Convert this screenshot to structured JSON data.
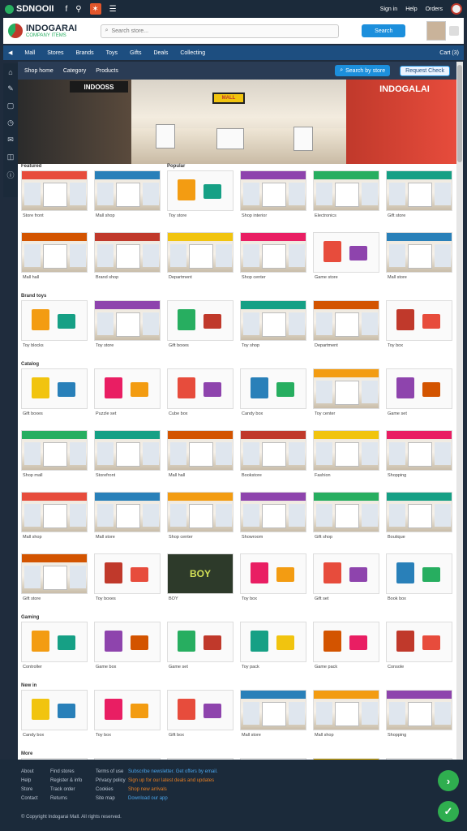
{
  "topbar": {
    "brand": "SDNOOII",
    "icons": [
      "facebook-icon",
      "share-icon",
      "pinwheel-icon",
      "menu-icon"
    ],
    "right": [
      "Sign in",
      "Help",
      "Orders"
    ]
  },
  "header": {
    "logo_title": "INDOGARAI",
    "logo_subtitle": "COMPANY ITEMS",
    "search_placeholder": "Search store...",
    "button_label": "Search"
  },
  "nav": {
    "items": [
      "Mall",
      "Stores",
      "Brands",
      "Toys",
      "Gifts",
      "Deals",
      "Collecting"
    ],
    "right": "Cart (3)"
  },
  "toolbar": {
    "items": [
      "Shop home",
      "Category",
      "Products"
    ],
    "button1": "Search by store",
    "button2": "Request Check"
  },
  "hero": {
    "left_sign": "INDOOSS",
    "right_sign": "INDOGALAI",
    "banner": "MALL"
  },
  "sections": [
    {
      "label": "Featured",
      "label2": "Popular",
      "rows": [
        {
          "caps": [
            "Store front",
            "Mall shop",
            "Toy store",
            "Shop interior",
            "Electronics",
            "Gift store"
          ],
          "types": [
            "store",
            "store",
            "prod",
            "store",
            "store",
            "store"
          ]
        },
        {
          "caps": [
            "Mall hall",
            "Brand shop",
            "Department",
            "Shop center",
            "Game store",
            "Mall store"
          ],
          "types": [
            "store",
            "store",
            "store",
            "store",
            "prod",
            "store"
          ]
        }
      ]
    },
    {
      "label": "Brand toys",
      "rows": [
        {
          "caps": [
            "Toy blocks",
            "Toy store",
            "Gift boxes",
            "Toy shop",
            "Department",
            "Toy box"
          ],
          "types": [
            "prod",
            "store",
            "prod",
            "store",
            "store",
            "prod"
          ]
        }
      ]
    },
    {
      "label": "Catalog",
      "rows": [
        {
          "caps": [
            "Gift boxes",
            "Puzzle set",
            "Cube box",
            "Candy box",
            "Toy center",
            "Game set"
          ],
          "types": [
            "prod",
            "prod",
            "prod",
            "prod",
            "store",
            "prod"
          ]
        },
        {
          "caps": [
            "Shop mall",
            "Storefront",
            "Mall hall",
            "Bookstore",
            "Fashion",
            "Shopping"
          ],
          "types": [
            "store",
            "store",
            "store",
            "store",
            "store",
            "store"
          ]
        },
        {
          "caps": [
            "Mall shop",
            "Mall store",
            "Shop center",
            "Showroom",
            "Gift shop",
            "Boutique"
          ],
          "types": [
            "store",
            "store",
            "store",
            "store",
            "store",
            "store"
          ]
        },
        {
          "caps": [
            "Gift store",
            "Toy boxes",
            "BOY",
            "Toy box",
            "Gift set",
            "Book box"
          ],
          "types": [
            "store",
            "prod",
            "dark",
            "prod",
            "prod",
            "prod"
          ]
        }
      ]
    },
    {
      "label": "Gaming",
      "rows": [
        {
          "caps": [
            "Controller",
            "Game box",
            "Game set",
            "Toy pack",
            "Game pack",
            "Console"
          ],
          "types": [
            "prod",
            "prod",
            "prod",
            "prod",
            "prod",
            "prod"
          ]
        }
      ]
    },
    {
      "label": "New in",
      "rows": [
        {
          "caps": [
            "Candy box",
            "Toy box",
            "Gift box",
            "Mall store",
            "Mall shop",
            "Shopping"
          ],
          "types": [
            "prod",
            "prod",
            "prod",
            "store",
            "store",
            "store"
          ]
        }
      ]
    },
    {
      "label": "More",
      "rows": [
        {
          "caps": [
            "",
            "",
            "",
            "",
            "",
            ""
          ],
          "types": [
            "prod",
            "prod",
            "prod",
            "prod",
            "store",
            "prod"
          ]
        }
      ]
    }
  ],
  "tile_colors": [
    "#e74c3c",
    "#2980b9",
    "#f39c12",
    "#8e44ad",
    "#27ae60",
    "#16a085",
    "#d35400",
    "#c0392b",
    "#f1c40f",
    "#e91e63"
  ],
  "footer": {
    "col1": [
      "About",
      "Help",
      "Store",
      "Contact"
    ],
    "col2": [
      "Find stores",
      "Register & info",
      "Track order",
      "Returns"
    ],
    "col3": [
      "Terms of use",
      "Privacy policy",
      "Cookies",
      "Site map"
    ],
    "col4_title": "Subscribe newsletter. Get offers by email.",
    "col4_lines": [
      "Sign up for our latest deals and updates",
      "Shop new arrivals",
      "Download our app"
    ],
    "bottom": "© Copyright Indogarai Mall. All rights reserved."
  }
}
